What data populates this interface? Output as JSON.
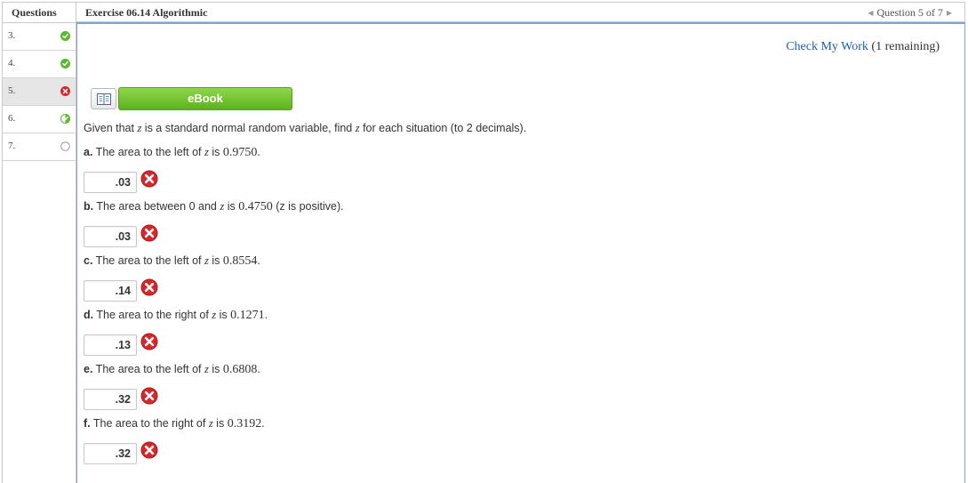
{
  "sidebar": {
    "header": "Questions",
    "items": [
      {
        "label": "3.",
        "status": "correct"
      },
      {
        "label": "4.",
        "status": "correct"
      },
      {
        "label": "5.",
        "status": "incorrect"
      },
      {
        "label": "6.",
        "status": "partial"
      },
      {
        "label": "7.",
        "status": "unanswered"
      }
    ]
  },
  "header": {
    "exercise_title": "Exercise 06.14 Algorithmic",
    "question_nav": "Question 5 of 7"
  },
  "check_work": {
    "link": "Check My Work",
    "remaining": "(1 remaining)"
  },
  "ebook": {
    "label": "eBook"
  },
  "question": {
    "intro_pre": "Given that ",
    "intro_var": "z",
    "intro_post": " is a standard normal random variable, find ",
    "intro_var2": "z",
    "intro_end": " for each situation (to 2 decimals).",
    "parts": [
      {
        "letter": "a.",
        "pre": " The area to the left of ",
        "var": "z",
        "mid": " is ",
        "value": "0.9750",
        "post": ".",
        "answer": ".03"
      },
      {
        "letter": "b.",
        "pre": " The area between 0 and ",
        "var": "z",
        "mid": " is ",
        "value": "0.4750",
        "post": " (z is positive).",
        "answer": ".03"
      },
      {
        "letter": "c.",
        "pre": " The area to the left of ",
        "var": "z",
        "mid": " is ",
        "value": "0.8554",
        "post": ".",
        "answer": ".14"
      },
      {
        "letter": "d.",
        "pre": " The area to the right of ",
        "var": "z",
        "mid": " is ",
        "value": "0.1271",
        "post": ".",
        "answer": ".13"
      },
      {
        "letter": "e.",
        "pre": " The area to the left of ",
        "var": "z",
        "mid": " is ",
        "value": "0.6808",
        "post": ".",
        "answer": ".32"
      },
      {
        "letter": "f.",
        "pre": " The area to the right of ",
        "var": "z",
        "mid": " is ",
        "value": "0.3192",
        "post": ".",
        "answer": ".32"
      }
    ]
  },
  "colors": {
    "correct": "#5cb82e",
    "incorrect": "#d9262c",
    "link": "#1a5fb4",
    "ebook_green": "#6cc52a",
    "panel_border": "#7fa6d6"
  },
  "icons": {
    "correct": "check-circle-icon",
    "incorrect": "x-circle-icon",
    "partial": "partial-check-icon",
    "unanswered": "empty-circle-icon",
    "ebook": "book-icon"
  }
}
